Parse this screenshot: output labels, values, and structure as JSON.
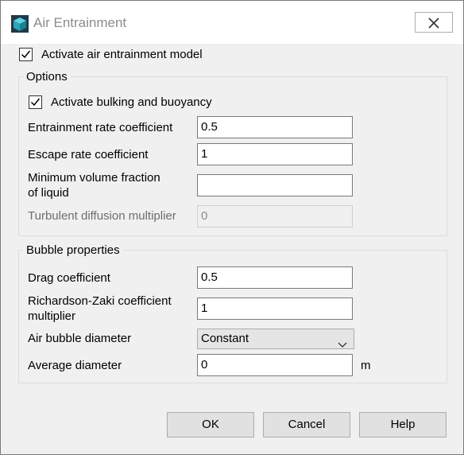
{
  "window": {
    "title": "Air Entrainment",
    "app_icon": "cube-icon",
    "close_icon": "close-icon"
  },
  "activate_model": {
    "label": "Activate air entrainment model",
    "checked": true
  },
  "options": {
    "title": "Options",
    "bulking": {
      "label": "Activate bulking and buoyancy",
      "checked": true
    },
    "entrainment_rate": {
      "label": "Entrainment rate coefficient",
      "value": "0.5"
    },
    "escape_rate": {
      "label": "Escape rate coefficient",
      "value": "1"
    },
    "min_volume_fraction": {
      "label_line1": "Minimum volume fraction",
      "label_line2": "of liquid",
      "value": ""
    },
    "turbulent_diffusion": {
      "label": "Turbulent diffusion multiplier",
      "value": "0"
    }
  },
  "bubble": {
    "title": "Bubble properties",
    "drag": {
      "label": "Drag coefficient",
      "value": "0.5"
    },
    "richardson": {
      "label_line1": "Richardson-Zaki coefficient",
      "label_line2": "multiplier",
      "value": "1"
    },
    "diameter_mode": {
      "label": "Air bubble diameter",
      "selected": "Constant"
    },
    "average_diameter": {
      "label": "Average diameter",
      "value": "0",
      "unit": "m"
    }
  },
  "buttons": {
    "ok": "OK",
    "cancel": "Cancel",
    "help": "Help"
  }
}
